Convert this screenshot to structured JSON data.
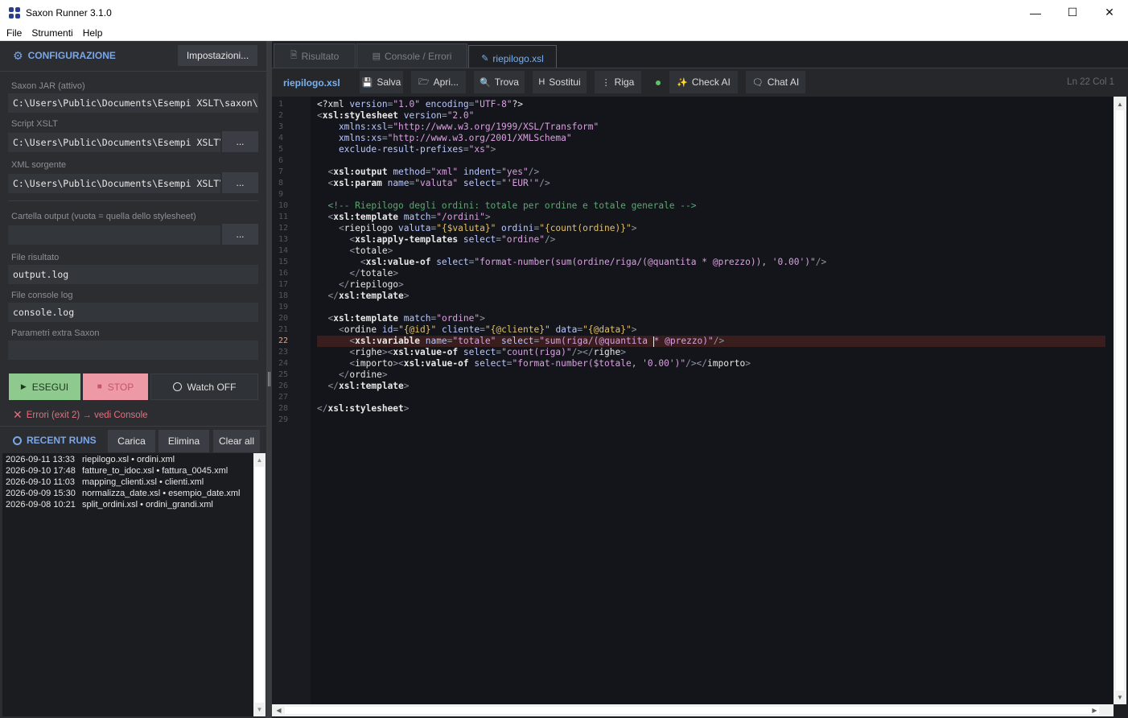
{
  "window": {
    "title": "Saxon Runner  3.1.0",
    "minimize": "—",
    "maximize": "☐",
    "close": "✕"
  },
  "menu": [
    "File",
    "Strumenti",
    "Help"
  ],
  "config": {
    "title": "CONFIGURAZIONE",
    "settings_button": "Impostazioni...",
    "saxon_jar_label": "Saxon JAR (attivo)",
    "saxon_jar_value": "C:\\Users\\Public\\Documents\\Esempi XSLT\\saxon\\",
    "script_label": "Script XSLT",
    "script_value": "C:\\Users\\Public\\Documents\\Esempi XSLT\\",
    "xml_label": "XML sorgente",
    "xml_value": "C:\\Users\\Public\\Documents\\Esempi XSLT\\",
    "output_dir_label": "Cartella output (vuota = quella dello stylesheet)",
    "output_dir_value": "",
    "result_file_label": "File risultato",
    "result_file_value": "output.log",
    "console_log_label": "File console log",
    "console_log_value": "console.log",
    "extra_params_label": "Parametri extra Saxon",
    "extra_params_value": "",
    "browse_label": "..."
  },
  "actions": {
    "run_icon": "▶",
    "run": "ESEGUI",
    "stop_icon": "■",
    "stop": "STOP",
    "watch": "Watch OFF",
    "status": "Errori (exit 2) → vedi Console",
    "status_color": "#e56f7f"
  },
  "recent": {
    "title": "RECENT RUNS",
    "load": "Carica",
    "delete": "Elimina",
    "clear": "Clear all",
    "rows": [
      {
        "ts": "2026-09-11 13:33",
        "desc": "riepilogo.xsl • ordini.xml"
      },
      {
        "ts": "2026-09-10 17:48",
        "desc": "fatture_to_idoc.xsl • fattura_0045.xml"
      },
      {
        "ts": "2026-09-10 11:03",
        "desc": "mapping_clienti.xsl • clienti.xml"
      },
      {
        "ts": "2026-09-09 15:30",
        "desc": "normalizza_date.xsl • esempio_date.xml"
      },
      {
        "ts": "2026-09-08 10:21",
        "desc": "split_ordini.xsl • ordini_grandi.xml"
      }
    ]
  },
  "tabs": [
    {
      "label": "Risultato",
      "icon": "doc-icon"
    },
    {
      "label": "Console / Errori",
      "icon": "console-icon"
    },
    {
      "label": "riepilogo.xsl",
      "icon": "pencil-icon",
      "active": true
    }
  ],
  "toolbar": {
    "file_name": "riepilogo.xsl",
    "save": "Salva",
    "open": "Apri...",
    "find": "Trova",
    "replace": "Sostitui",
    "replace_icon": "H",
    "line": "Riga",
    "check_ai": "Check AI",
    "chat_ai": "Chat AI",
    "cursor": "Ln 22  Col 1",
    "accent": "#7ab0f0"
  },
  "editor": {
    "current_line": 22,
    "lines": [
      [
        [
          "t-tag",
          "<?xml "
        ],
        [
          "t-attr",
          "version"
        ],
        [
          "t-pun",
          "="
        ],
        [
          "t-str",
          "\"1.0\""
        ],
        [
          "t-attr",
          " encoding"
        ],
        [
          "t-pun",
          "="
        ],
        [
          "t-str",
          "\"UTF-8\""
        ],
        [
          "t-tag",
          "?>"
        ]
      ],
      [
        [
          "t-pun",
          "<"
        ],
        [
          "t-b",
          "xsl:stylesheet"
        ],
        [
          "t-attr",
          " version"
        ],
        [
          "t-pun",
          "="
        ],
        [
          "t-str",
          "\"2.0\""
        ]
      ],
      [
        [
          "t-attr",
          "    xmlns:xsl"
        ],
        [
          "t-pun",
          "="
        ],
        [
          "t-str",
          "\"http://www.w3.org/1999/XSL/Transform\""
        ]
      ],
      [
        [
          "t-attr",
          "    xmlns:xs"
        ],
        [
          "t-pun",
          "="
        ],
        [
          "t-str",
          "\"http://www.w3.org/2001/XMLSchema\""
        ]
      ],
      [
        [
          "t-attr",
          "    exclude-result-prefixes"
        ],
        [
          "t-pun",
          "="
        ],
        [
          "t-str",
          "\"xs\""
        ],
        [
          "t-pun",
          ">"
        ]
      ],
      [],
      [
        [
          "t-pun",
          "  <"
        ],
        [
          "t-b",
          "xsl:output"
        ],
        [
          "t-attr",
          " method"
        ],
        [
          "t-pun",
          "="
        ],
        [
          "t-str",
          "\"xml\""
        ],
        [
          "t-attr",
          " indent"
        ],
        [
          "t-pun",
          "="
        ],
        [
          "t-str",
          "\"yes\""
        ],
        [
          "t-pun",
          "/>"
        ]
      ],
      [
        [
          "t-pun",
          "  <"
        ],
        [
          "t-b",
          "xsl:param"
        ],
        [
          "t-attr",
          " name"
        ],
        [
          "t-pun",
          "="
        ],
        [
          "t-str",
          "\"valuta\""
        ],
        [
          "t-attr",
          " select"
        ],
        [
          "t-pun",
          "="
        ],
        [
          "t-str",
          "\"'EUR'\""
        ],
        [
          "t-pun",
          "/>"
        ]
      ],
      [],
      [
        [
          "t-com",
          "  <!-- Riepilogo degli ordini: totale per ordine e totale generale -->"
        ]
      ],
      [
        [
          "t-pun",
          "  <"
        ],
        [
          "t-b",
          "xsl:template"
        ],
        [
          "t-attr",
          " match"
        ],
        [
          "t-pun",
          "="
        ],
        [
          "t-str",
          "\"/ordini\""
        ],
        [
          "t-pun",
          ">"
        ]
      ],
      [
        [
          "t-pun",
          "    <"
        ],
        [
          "t-tag",
          "riepilogo"
        ],
        [
          "t-attr",
          " valuta"
        ],
        [
          "t-pun",
          "="
        ],
        [
          "t-xp",
          "\"{$valuta}\""
        ],
        [
          "t-attr",
          " ordini"
        ],
        [
          "t-pun",
          "="
        ],
        [
          "t-xp",
          "\"{count(ordine)}\""
        ],
        [
          "t-pun",
          ">"
        ]
      ],
      [
        [
          "t-pun",
          "      <"
        ],
        [
          "t-b",
          "xsl:apply-templates"
        ],
        [
          "t-attr",
          " select"
        ],
        [
          "t-pun",
          "="
        ],
        [
          "t-str",
          "\"ordine\""
        ],
        [
          "t-pun",
          "/>"
        ]
      ],
      [
        [
          "t-pun",
          "      <"
        ],
        [
          "t-tag",
          "totale"
        ],
        [
          "t-pun",
          ">"
        ]
      ],
      [
        [
          "t-pun",
          "        <"
        ],
        [
          "t-b",
          "xsl:value-of"
        ],
        [
          "t-attr",
          " select"
        ],
        [
          "t-pun",
          "="
        ],
        [
          "t-str",
          "\"format-number(sum(ordine/riga/(@quantita * @prezzo)), '0.00')\""
        ],
        [
          "t-pun",
          "/>"
        ]
      ],
      [
        [
          "t-pun",
          "      </"
        ],
        [
          "t-tag",
          "totale"
        ],
        [
          "t-pun",
          ">"
        ]
      ],
      [
        [
          "t-pun",
          "    </"
        ],
        [
          "t-tag",
          "riepilogo"
        ],
        [
          "t-pun",
          ">"
        ]
      ],
      [
        [
          "t-pun",
          "  </"
        ],
        [
          "t-b",
          "xsl:template"
        ],
        [
          "t-pun",
          ">"
        ]
      ],
      [],
      [
        [
          "t-pun",
          "  <"
        ],
        [
          "t-b",
          "xsl:template"
        ],
        [
          "t-attr",
          " match"
        ],
        [
          "t-pun",
          "="
        ],
        [
          "t-str",
          "\"ordine\""
        ],
        [
          "t-pun",
          ">"
        ]
      ],
      [
        [
          "t-pun",
          "    <"
        ],
        [
          "t-tag",
          "ordine"
        ],
        [
          "t-attr",
          " id"
        ],
        [
          "t-pun",
          "="
        ],
        [
          "t-xp",
          "\"{@id}\""
        ],
        [
          "t-attr",
          " cliente"
        ],
        [
          "t-pun",
          "="
        ],
        [
          "t-xp",
          "\"{@cliente}\""
        ],
        [
          "t-attr",
          " data"
        ],
        [
          "t-pun",
          "="
        ],
        [
          "t-xp",
          "\"{@data}\""
        ],
        [
          "t-pun",
          ">"
        ]
      ],
      [
        [
          "t-pun",
          "      <"
        ],
        [
          "t-b",
          "xsl:variable"
        ],
        [
          "t-attr",
          " name"
        ],
        [
          "t-pun",
          "="
        ],
        [
          "t-str",
          "\"totale\""
        ],
        [
          "t-attr",
          " select"
        ],
        [
          "t-pun",
          "="
        ],
        [
          "t-str",
          "\"sum(riga/(@quantita "
        ],
        [
          "caret",
          ""
        ],
        [
          "t-str",
          "* @prezzo)\""
        ],
        [
          "t-pun",
          "/>"
        ]
      ],
      [
        [
          "t-pun",
          "      <"
        ],
        [
          "t-tag",
          "righe"
        ],
        [
          "t-pun",
          "><"
        ],
        [
          "t-b",
          "xsl:value-of"
        ],
        [
          "t-attr",
          " select"
        ],
        [
          "t-pun",
          "="
        ],
        [
          "t-str",
          "\"count(riga)\""
        ],
        [
          "t-pun",
          "/></"
        ],
        [
          "t-tag",
          "righe"
        ],
        [
          "t-pun",
          ">"
        ]
      ],
      [
        [
          "t-pun",
          "      <"
        ],
        [
          "t-tag",
          "importo"
        ],
        [
          "t-pun",
          "><"
        ],
        [
          "t-b",
          "xsl:value-of"
        ],
        [
          "t-attr",
          " select"
        ],
        [
          "t-pun",
          "="
        ],
        [
          "t-str",
          "\"format-number($totale, '0.00')\""
        ],
        [
          "t-pun",
          "/></"
        ],
        [
          "t-tag",
          "importo"
        ],
        [
          "t-pun",
          ">"
        ]
      ],
      [
        [
          "t-pun",
          "    </"
        ],
        [
          "t-tag",
          "ordine"
        ],
        [
          "t-pun",
          ">"
        ]
      ],
      [
        [
          "t-pun",
          "  </"
        ],
        [
          "t-b",
          "xsl:template"
        ],
        [
          "t-pun",
          ">"
        ]
      ],
      [],
      [
        [
          "t-pun",
          "</"
        ],
        [
          "t-b",
          "xsl:stylesheet"
        ],
        [
          "t-pun",
          ">"
        ]
      ],
      []
    ]
  }
}
